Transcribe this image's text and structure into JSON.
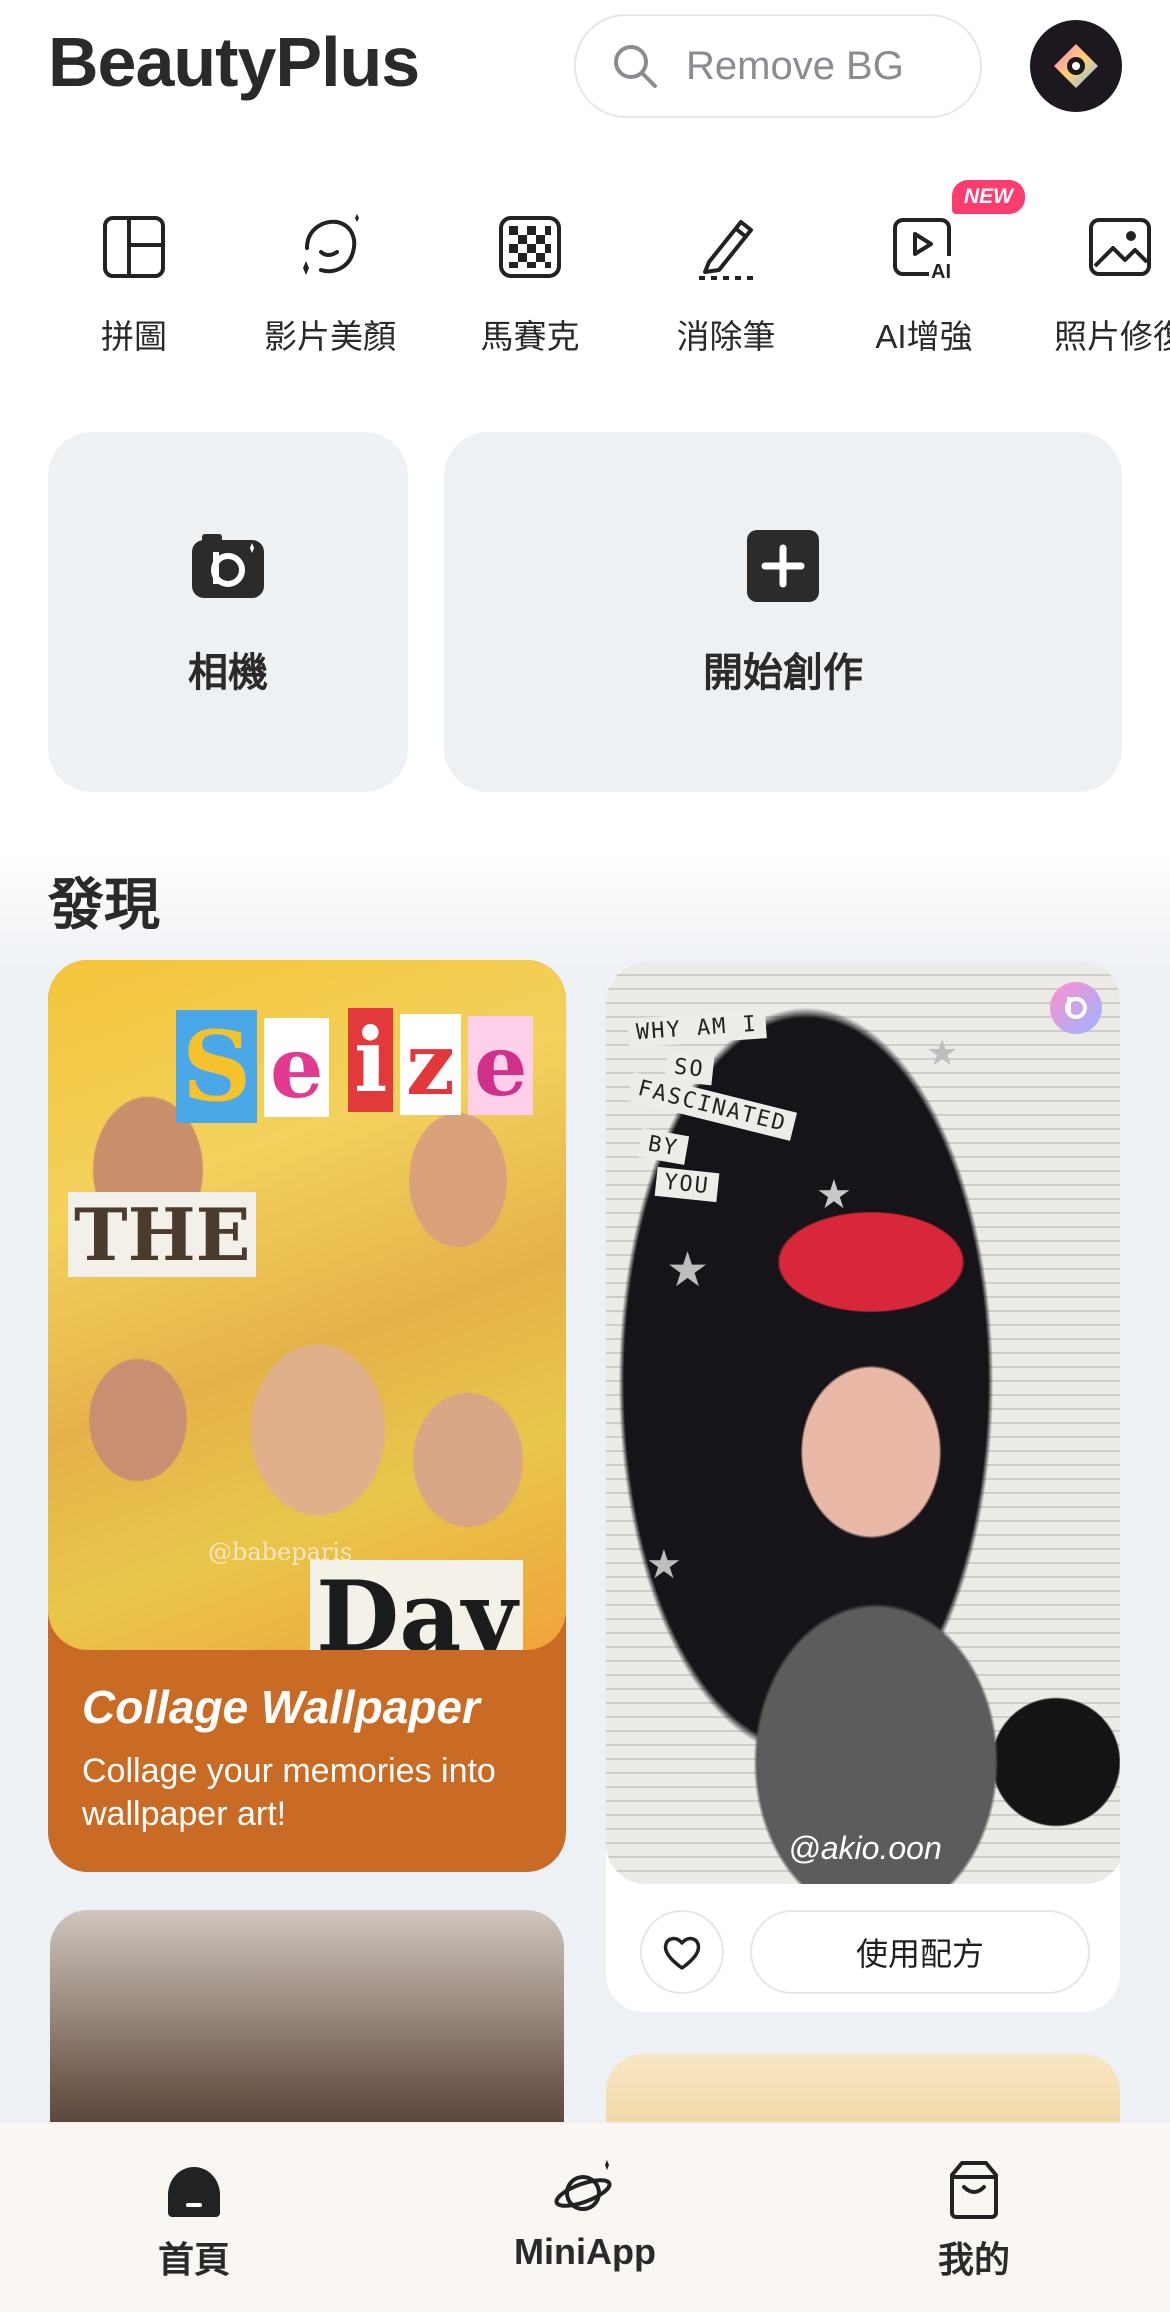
{
  "header": {
    "app_title": "BeautyPlus",
    "search_placeholder": "Remove BG"
  },
  "tools": [
    {
      "label": "拼圖",
      "icon": "collage-grid-icon"
    },
    {
      "label": "影片美顏",
      "icon": "face-sparkle-icon"
    },
    {
      "label": "馬賽克",
      "icon": "mosaic-icon"
    },
    {
      "label": "消除筆",
      "icon": "eraser-pen-icon"
    },
    {
      "label": "AI增強",
      "icon": "ai-enhance-icon",
      "badge": "NEW"
    },
    {
      "label": "照片修復",
      "icon": "photo-repair-icon"
    }
  ],
  "quick_actions": {
    "camera_label": "相機",
    "create_label": "開始創作"
  },
  "discover": {
    "title": "發現",
    "collage_card": {
      "title": "Collage Wallpaper",
      "subtitle": "Collage your memories into wallpaper art!",
      "cutouts": [
        "S",
        "e",
        "i",
        "z",
        "e",
        "THE",
        "Day"
      ],
      "watermark": "@babeparis"
    },
    "recipe_card": {
      "note_lines": [
        "WHY AM I",
        "SO",
        "FASCINATED",
        "BY",
        "YOU"
      ],
      "handle": "@akio.oon",
      "use_label": "使用配方"
    }
  },
  "bottom_nav": {
    "home": "首頁",
    "miniapp": "MiniApp",
    "mine": "我的"
  },
  "colors": {
    "accent_badge": "#ff3c6e",
    "collage_card": "#c96b24",
    "card_bg": "#eef1f4"
  }
}
